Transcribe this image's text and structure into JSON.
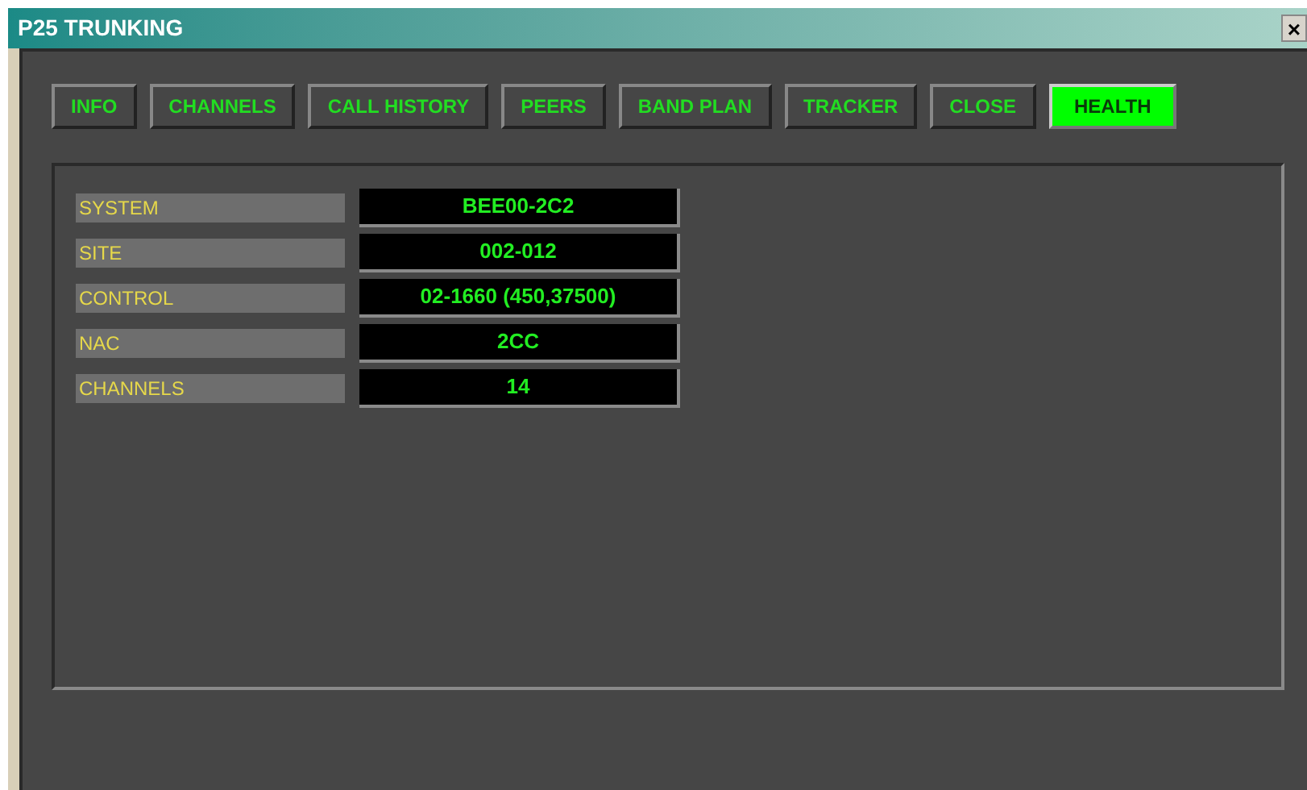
{
  "window": {
    "title": "P25 TRUNKING",
    "close": "×"
  },
  "tabs": [
    {
      "label": "INFO",
      "selected": false
    },
    {
      "label": "CHANNELS",
      "selected": false
    },
    {
      "label": "CALL HISTORY",
      "selected": false
    },
    {
      "label": "PEERS",
      "selected": false
    },
    {
      "label": "BAND PLAN",
      "selected": false
    },
    {
      "label": "TRACKER",
      "selected": false
    },
    {
      "label": "CLOSE",
      "selected": false
    },
    {
      "label": "HEALTH",
      "selected": true
    }
  ],
  "info": [
    {
      "label": "SYSTEM",
      "value": "BEE00-2C2"
    },
    {
      "label": "SITE",
      "value": "002-012"
    },
    {
      "label": "CONTROL",
      "value": "02-1660 (450,37500)"
    },
    {
      "label": "NAC",
      "value": "2CC"
    },
    {
      "label": "CHANNELS",
      "value": "14"
    }
  ]
}
